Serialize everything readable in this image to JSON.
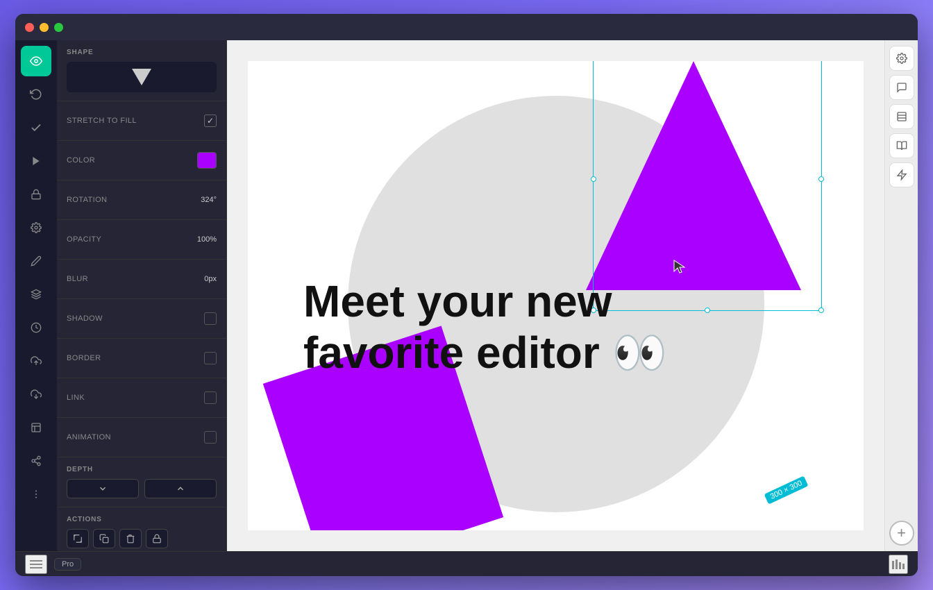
{
  "window": {
    "titlebar": {
      "traffic_lights": [
        "close",
        "minimize",
        "maximize"
      ]
    }
  },
  "icon_toolbar": {
    "items": [
      {
        "id": "eye",
        "icon": "👁",
        "active": true
      },
      {
        "id": "undo",
        "icon": "↺",
        "active": false
      },
      {
        "id": "check",
        "icon": "✓",
        "active": false
      },
      {
        "id": "play",
        "icon": "▶",
        "active": false
      },
      {
        "id": "lock",
        "icon": "🔒",
        "active": false
      },
      {
        "id": "settings",
        "icon": "⚙",
        "active": false
      },
      {
        "id": "pen",
        "icon": "✏",
        "active": false
      },
      {
        "id": "layers",
        "icon": "◫",
        "active": false
      },
      {
        "id": "clock",
        "icon": "⏱",
        "active": false
      },
      {
        "id": "upload",
        "icon": "⬆",
        "active": false
      },
      {
        "id": "download",
        "icon": "⬇",
        "active": false
      },
      {
        "id": "gallery",
        "icon": "▦",
        "active": false
      },
      {
        "id": "share",
        "icon": "⎇",
        "active": false
      },
      {
        "id": "more",
        "icon": "⋮",
        "active": false
      }
    ]
  },
  "properties": {
    "shape_label": "SHAPE",
    "stretch_label": "STRETCH TO FILL",
    "stretch_checked": true,
    "color_label": "COLOR",
    "color_value": "#aa00ff",
    "rotation_label": "ROTATION",
    "rotation_value": "324°",
    "opacity_label": "OPACITY",
    "opacity_value": "100%",
    "blur_label": "BLUR",
    "blur_value": "0px",
    "shadow_label": "SHADOW",
    "shadow_checked": false,
    "border_label": "BORDER",
    "border_checked": false,
    "link_label": "LINK",
    "link_checked": false,
    "animation_label": "ANIMATION",
    "animation_checked": false,
    "depth_label": "DEPTH",
    "depth_down": "⌄",
    "depth_up": "⌃",
    "actions_label": "ACTIONS",
    "action_crop": "⊞",
    "action_copy": "⎘",
    "action_delete": "🗑",
    "action_lock": "🔒"
  },
  "canvas": {
    "main_text_line1": "Meet your new",
    "main_text_line2": "favorite editor 👀",
    "size_badge": "300 × 300"
  },
  "right_panel": {
    "tools": [
      "💬",
      "▬",
      "📖",
      "⚡"
    ],
    "add_label": "+"
  },
  "bottom_bar": {
    "menu_icon": "≡",
    "pro_label": "Pro",
    "stats_icon": "|||"
  }
}
